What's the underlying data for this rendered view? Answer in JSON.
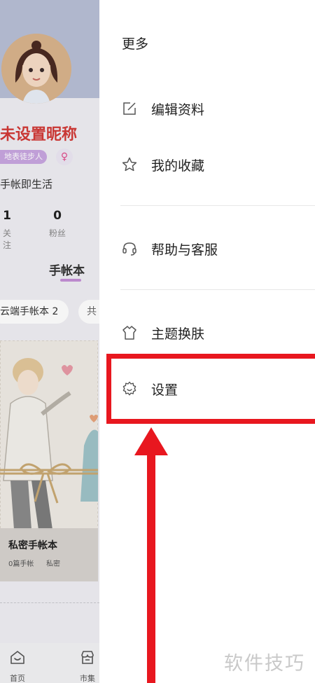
{
  "profile": {
    "nickname": "未设置昵称",
    "level_badge": "地表徒步人",
    "gender_symbol": "♀",
    "bio": "手帐即生活",
    "following": {
      "count": "1",
      "label": "关注"
    },
    "fans": {
      "count": "0",
      "label": "粉丝"
    },
    "tab_label": "手帐本",
    "chips": [
      "云端手帐本 2",
      "共"
    ],
    "notebook": {
      "title": "私密手帐本",
      "count": "0篇手帐",
      "privacy": "私密"
    }
  },
  "tabbar": {
    "home_label": "首页",
    "market_label": "市集"
  },
  "drawer": {
    "title": "更多",
    "items": [
      {
        "label": "编辑资料",
        "icon": "edit-icon"
      },
      {
        "label": "我的收藏",
        "icon": "star-icon"
      },
      {
        "label": "帮助与客服",
        "icon": "headset-icon"
      },
      {
        "label": "主题换肤",
        "icon": "theme-icon"
      },
      {
        "label": "设置",
        "icon": "gear-icon"
      }
    ]
  },
  "annotation": {
    "color": "#e8171f"
  },
  "watermark": "软件技巧"
}
